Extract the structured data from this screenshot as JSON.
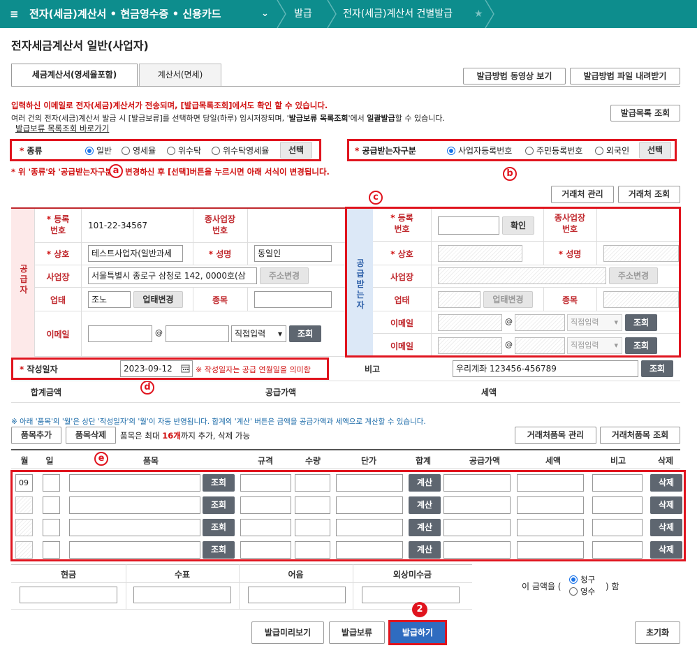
{
  "topbar": {
    "menu_icon": "≡",
    "section": "전자(세금)계산서 • 현금영수증 • 신용카드",
    "crumb1": "발급",
    "crumb2": "전자(세금)계산서 건별발급",
    "star": "★"
  },
  "page_title": "전자세금계산서 일반(사업자)",
  "tabs": {
    "tab1": "세금계산서(영세율포함)",
    "tab2": "계산서(면세)"
  },
  "top_buttons": {
    "video": "발급방법 동영상 보기",
    "file": "발급방법 파일 내려받기",
    "list": "발급목록 조회"
  },
  "notice": {
    "line1": "입력하신 이메일로 전자(세금)계산서가 전송되며, [발급목록조회]에서도 확인 할 수 있습니다.",
    "line2a": "여러 건의 전자(세금)계산서 발급 시 [발급보류]를 선택하면 당일(하루) 임시저장되며, '",
    "line2b": "발급보류 목록조회",
    "line2c": "'에서 ",
    "line2d": "일괄발급",
    "line2e": "할 수 있습니다.",
    "link": "발급보류 목록조회 바로가기"
  },
  "type": {
    "label": "종류",
    "opt1": "일반",
    "opt2": "영세율",
    "opt3": "위수탁",
    "opt4": "위수탁영세율",
    "select": "선택"
  },
  "recv_type": {
    "label": "공급받는자구분",
    "opt1": "사업자등록번호",
    "opt2": "주민등록번호",
    "opt3": "외국인",
    "select": "선택"
  },
  "change_notice": "* 위 '종류'와 '공급받는자구분'을 변경하신 후 [선택]버튼을 누르시면 아래 서식이 변경됩니다.",
  "markers": {
    "a": "a",
    "b": "b",
    "c": "c",
    "d": "d",
    "e": "e",
    "step": "2"
  },
  "partner_buttons": {
    "manage": "거래처 관리",
    "lookup": "거래처 조회"
  },
  "supplier": {
    "side": "공급자",
    "reg_label1": "등록",
    "reg_label2": "번호",
    "reg_value": "101-22-34567",
    "sub_label1": "종사업장",
    "sub_label2": "번호",
    "name_label": "상호",
    "name_value": "테스트사업자(일반과세",
    "ceo_label": "성명",
    "ceo_value": "동일인",
    "addr_label": "사업장",
    "addr_value": "서울특별시 종로구 삼청로 142, 0000호(삼",
    "addr_btn": "주소변경",
    "biz_label": "업태",
    "biz_value": "조노",
    "biz_btn": "업태변경",
    "item_label": "종목",
    "email_label": "이메일",
    "at": "@",
    "domain": "직접입력",
    "lookup": "조회"
  },
  "receiver": {
    "side": "공급받는자",
    "reg_label1": "등록",
    "reg_label2": "번호",
    "confirm": "확인",
    "sub_label1": "종사업장",
    "sub_label2": "번호",
    "name_label": "상호",
    "ceo_label": "성명",
    "addr_label": "사업장",
    "addr_btn": "주소변경",
    "biz_label": "업태",
    "biz_btn": "업태변경",
    "item_label": "종목",
    "email_label": "이메일",
    "at": "@",
    "domain": "직접입력",
    "lookup": "조회"
  },
  "date": {
    "label": "작성일자",
    "value": "2023-09-12",
    "note": "※ 작성일자는 공급 연월일을 의미함"
  },
  "memo": {
    "label": "비고",
    "value": "우리계좌 123456-456789",
    "lookup": "조회"
  },
  "totals": {
    "total": "합계금액",
    "supply": "공급가액",
    "tax": "세액"
  },
  "items_notice": "※ 아래 '품목'의 '월'은 상단 '작성일자'의 '월'이 자동 반영됩니다. 합계의 '계산' 버튼은 금액을 공급가액과 세액으로 계산할 수 있습니다.",
  "items_bar": {
    "add": "품목추가",
    "del": "품목삭제",
    "note_a": "품목은 최대 ",
    "note_b": "16개",
    "note_c": "까지 추가, 삭제 가능",
    "manage": "거래처품목 관리",
    "lookup": "거래처품목 조회"
  },
  "items_headers": [
    "월",
    "일",
    "품목",
    "규격",
    "수량",
    "단가",
    "합계",
    "공급가액",
    "세액",
    "비고",
    "삭제"
  ],
  "item_rows": [
    {
      "month": "09",
      "lookup": "조회",
      "calc": "계산",
      "del": "삭제"
    },
    {
      "month": "",
      "lookup": "조회",
      "calc": "계산",
      "del": "삭제"
    },
    {
      "month": "",
      "lookup": "조회",
      "calc": "계산",
      "del": "삭제"
    },
    {
      "month": "",
      "lookup": "조회",
      "calc": "계산",
      "del": "삭제"
    }
  ],
  "payment": {
    "cash": "현금",
    "check": "수표",
    "note": "어음",
    "credit": "외상미수금",
    "amount_pre": "이 금액을 (",
    "claim": "청구",
    "receipt": "영수",
    "amount_post": ") 함"
  },
  "bottom": {
    "preview": "발급미리보기",
    "hold": "발급보류",
    "issue": "발급하기",
    "reset": "초기화"
  }
}
